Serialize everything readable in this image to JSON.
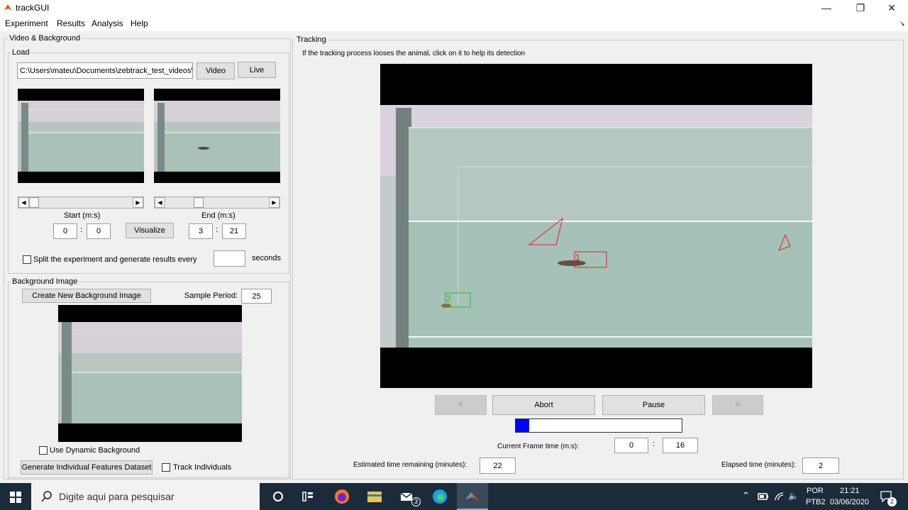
{
  "window": {
    "title": "trackGUI"
  },
  "menu": [
    "Experiment",
    "Results",
    "Analysis",
    "Help"
  ],
  "video_bg": {
    "title": "Video & Background",
    "load": {
      "title": "Load",
      "path": "C:\\Users\\mateu\\Documents\\zebtrack_test_videos\\mais",
      "video_label": "Video",
      "live_label": "Live",
      "start_label": "Start (m:s)",
      "end_label": "End (m:s)",
      "start_min": "0",
      "start_sec": "0",
      "end_min": "3",
      "end_sec": "21",
      "colon": ":",
      "visualize_label": "Visualize",
      "split_label": "Split the experiment and generate results every",
      "split_value": "",
      "seconds_label": "seconds",
      "start_slider_fraction": 0.0,
      "end_slider_fraction": 0.3
    },
    "background": {
      "title": "Background Image",
      "create_label": "Create New Background Image",
      "sample_period_label": "Sample Period:",
      "sample_period": "25",
      "dynamic_label": "Use Dynamic Background",
      "generate_label": "Generate Individual Features Dataset",
      "track_label": "Track Individuals"
    }
  },
  "tracking": {
    "title": "Tracking",
    "hint": "If the tracking process looses the animal, click on it to help its detection",
    "markers": [
      "1",
      "2"
    ],
    "prev_label": "<",
    "abort_label": "Abort",
    "pause_label": "Pause",
    "next_label": ">",
    "progress": 0.08,
    "frame_time_label": "Current Frame time (m:s):",
    "frame_min": "0",
    "frame_sec": "16",
    "colon": ":",
    "remaining_label": "Estimated time remaining (minutes):",
    "remaining": "22",
    "elapsed_label": "Elapsed time (minutes):",
    "elapsed": "2"
  },
  "taskbar": {
    "search_placeholder": "Digite aqui para pesquisar",
    "lang1": "POR",
    "lang2": "PTB2",
    "time": "21:21",
    "date": "03/06/2020",
    "mail_badge": "3",
    "notif_badge": "2"
  },
  "colors": {
    "progress": "#0000ff",
    "taskbar": "#1c2b3a",
    "marker_red": "#e02020",
    "marker_green": "#20c020"
  }
}
